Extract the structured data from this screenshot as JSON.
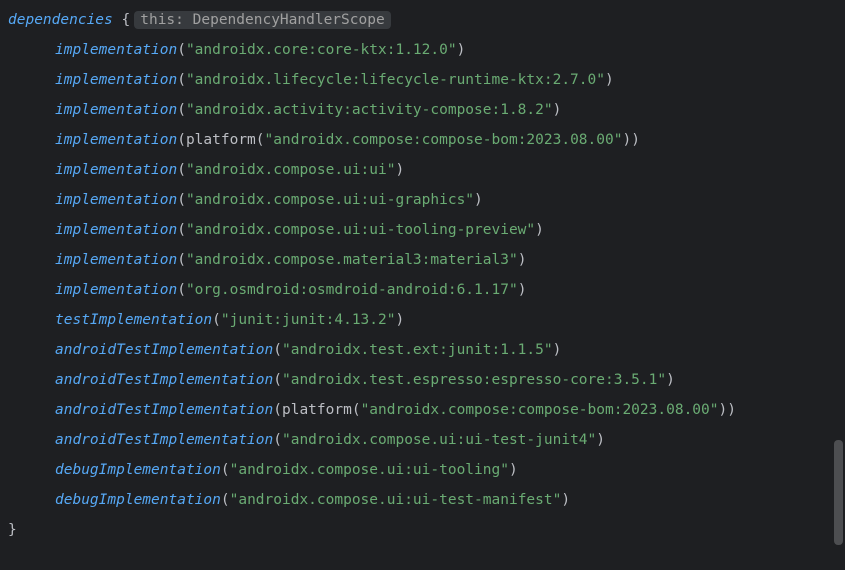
{
  "block": {
    "name": "dependencies",
    "brace_open": "{",
    "brace_close": "}",
    "type_hint_this": "this:",
    "type_hint_type": "DependencyHandlerScope"
  },
  "calls": [
    {
      "fn": "implementation",
      "wrap": null,
      "arg": "\"androidx.core:core-ktx:1.12.0\""
    },
    {
      "fn": "implementation",
      "wrap": null,
      "arg": "\"androidx.lifecycle:lifecycle-runtime-ktx:2.7.0\""
    },
    {
      "fn": "implementation",
      "wrap": null,
      "arg": "\"androidx.activity:activity-compose:1.8.2\""
    },
    {
      "fn": "implementation",
      "wrap": "platform",
      "arg": "\"androidx.compose:compose-bom:2023.08.00\""
    },
    {
      "fn": "implementation",
      "wrap": null,
      "arg": "\"androidx.compose.ui:ui\""
    },
    {
      "fn": "implementation",
      "wrap": null,
      "arg": "\"androidx.compose.ui:ui-graphics\""
    },
    {
      "fn": "implementation",
      "wrap": null,
      "arg": "\"androidx.compose.ui:ui-tooling-preview\""
    },
    {
      "fn": "implementation",
      "wrap": null,
      "arg": "\"androidx.compose.material3:material3\""
    },
    {
      "fn": "implementation",
      "wrap": null,
      "arg": "\"org.osmdroid:osmdroid-android:6.1.17\""
    },
    {
      "fn": "testImplementation",
      "wrap": null,
      "arg": "\"junit:junit:4.13.2\""
    },
    {
      "fn": "androidTestImplementation",
      "wrap": null,
      "arg": "\"androidx.test.ext:junit:1.1.5\""
    },
    {
      "fn": "androidTestImplementation",
      "wrap": null,
      "arg": "\"androidx.test.espresso:espresso-core:3.5.1\""
    },
    {
      "fn": "androidTestImplementation",
      "wrap": "platform",
      "arg": "\"androidx.compose:compose-bom:2023.08.00\""
    },
    {
      "fn": "androidTestImplementation",
      "wrap": null,
      "arg": "\"androidx.compose.ui:ui-test-junit4\""
    },
    {
      "fn": "debugImplementation",
      "wrap": null,
      "arg": "\"androidx.compose.ui:ui-tooling\""
    },
    {
      "fn": "debugImplementation",
      "wrap": null,
      "arg": "\"androidx.compose.ui:ui-test-manifest\""
    }
  ]
}
